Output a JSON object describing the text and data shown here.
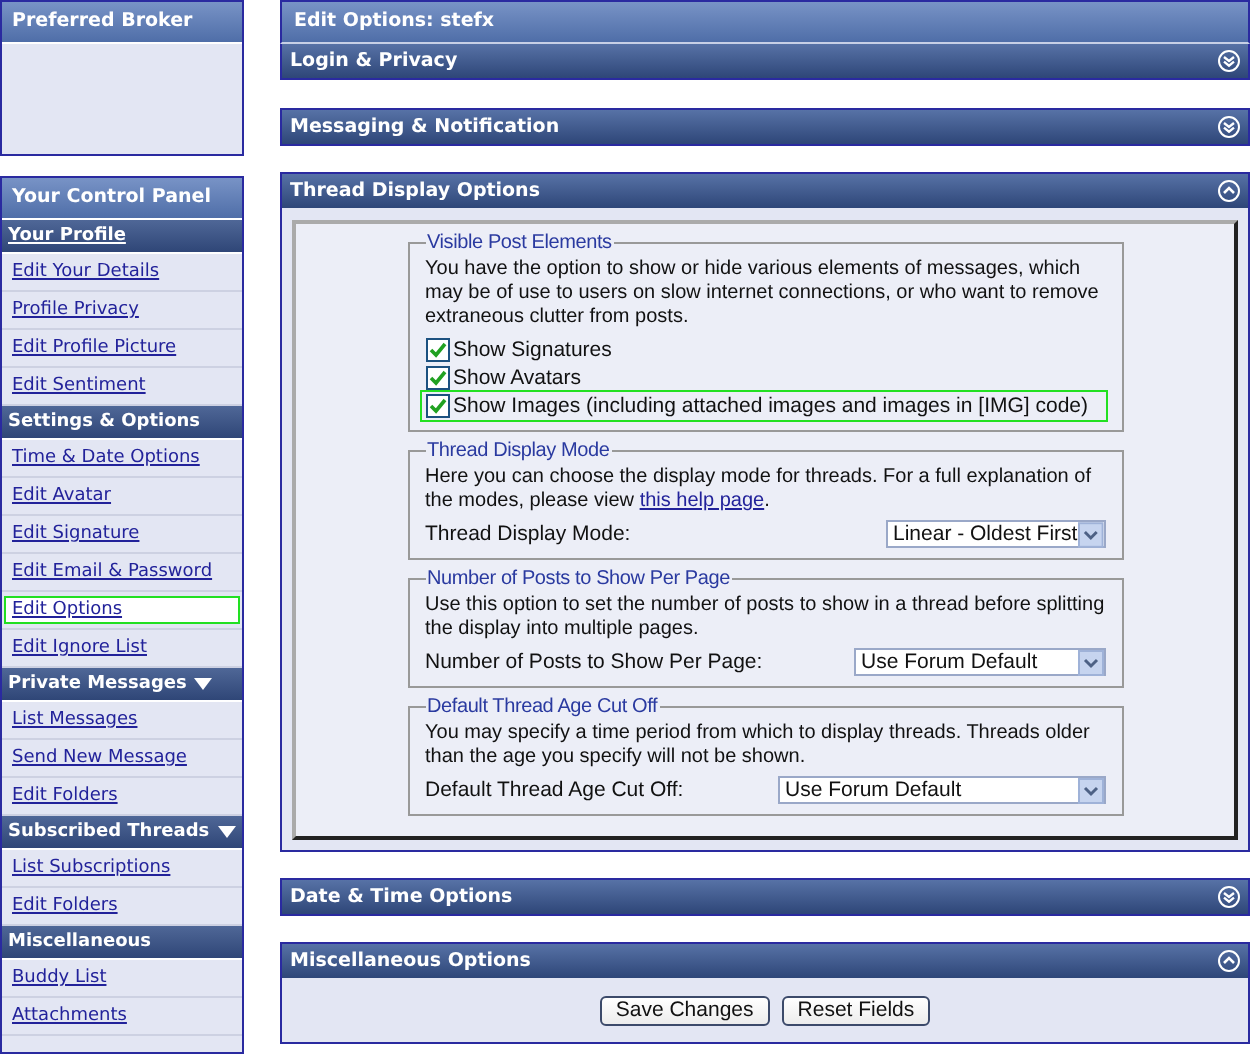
{
  "sidebar": {
    "broker_panel": {
      "title": "Preferred Broker"
    },
    "control_panel": {
      "title": "Your Control Panel",
      "sections": [
        {
          "title": "Your Profile",
          "underlined": true,
          "has_menu": false,
          "items": [
            {
              "label": "Edit Your Details",
              "highlighted": false
            },
            {
              "label": "Profile Privacy",
              "highlighted": false
            },
            {
              "label": "Edit Profile Picture",
              "highlighted": false
            },
            {
              "label": "Edit Sentiment",
              "highlighted": false
            }
          ]
        },
        {
          "title": "Settings & Options",
          "underlined": false,
          "has_menu": false,
          "items": [
            {
              "label": "Time & Date Options",
              "highlighted": false
            },
            {
              "label": "Edit Avatar",
              "highlighted": false
            },
            {
              "label": "Edit Signature",
              "highlighted": false
            },
            {
              "label": "Edit Email & Password",
              "highlighted": false
            },
            {
              "label": "Edit Options",
              "highlighted": true
            },
            {
              "label": "Edit Ignore List",
              "highlighted": false
            }
          ]
        },
        {
          "title": "Private Messages",
          "underlined": false,
          "has_menu": true,
          "items": [
            {
              "label": "List Messages",
              "highlighted": false
            },
            {
              "label": "Send New Message",
              "highlighted": false
            },
            {
              "label": "Edit Folders",
              "highlighted": false
            }
          ]
        },
        {
          "title": "Subscribed Threads",
          "underlined": false,
          "has_menu": true,
          "items": [
            {
              "label": "List Subscriptions",
              "highlighted": false
            },
            {
              "label": "Edit Folders",
              "highlighted": false
            }
          ]
        },
        {
          "title": "Miscellaneous",
          "underlined": false,
          "has_menu": false,
          "items": [
            {
              "label": "Buddy List",
              "highlighted": false
            },
            {
              "label": "Attachments",
              "highlighted": false
            }
          ]
        }
      ]
    }
  },
  "main": {
    "title": "Edit Options: stefx",
    "panels": [
      {
        "title": "Login & Privacy",
        "expanded": false
      },
      {
        "title": "Messaging & Notification",
        "expanded": false
      },
      {
        "title": "Thread Display Options",
        "expanded": true,
        "fieldsets": [
          {
            "kind": "checkboxes",
            "legend": "Visible Post Elements",
            "description": "You have the option to show or hide various elements of messages, which may be of use to users on slow internet connections, or who want to remove extraneous clutter from posts.",
            "options": [
              {
                "label": "Show Signatures",
                "checked": true,
                "highlighted": false
              },
              {
                "label": "Show Avatars",
                "checked": true,
                "highlighted": false
              },
              {
                "label": "Show Images (including attached images and images in [IMG] code)",
                "checked": true,
                "highlighted": true
              }
            ]
          },
          {
            "kind": "select",
            "legend": "Thread Display Mode",
            "description": "Here you can choose the display mode for threads. For a full explanation of the modes, please view",
            "link": "this help page",
            "link_suffix": ".",
            "label": "Thread Display Mode:",
            "value": "Linear - Oldest First"
          },
          {
            "kind": "select",
            "legend": "Number of Posts to Show Per Page",
            "description": "Use this option to set the number of posts to show in a thread before splitting the display into multiple pages.",
            "label": "Number of Posts to Show Per Page:",
            "value": "Use Forum Default"
          },
          {
            "kind": "select",
            "legend": "Default Thread Age Cut Off",
            "description": "You may specify a time period from which to display threads. Threads older than the age you specify will not be shown.",
            "label": "Default Thread Age Cut Off:",
            "value": "Use Forum Default"
          }
        ]
      },
      {
        "title": "Date & Time Options",
        "expanded": false
      },
      {
        "title": "Miscellaneous Options",
        "expanded": true,
        "buttons": [
          "Save Changes",
          "Reset Fields"
        ]
      }
    ]
  }
}
